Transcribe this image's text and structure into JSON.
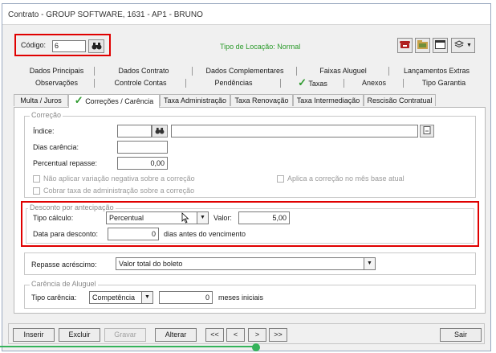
{
  "window": {
    "title": "Contrato - GROUP SOFTWARE, 1631 - AP1 - BRUNO"
  },
  "header": {
    "codigo_label": "Código:",
    "codigo_value": "6",
    "tipo_locacao": "Tipo de Locação:  Normal",
    "icons": [
      "binoculars-icon",
      "phone-icon",
      "folder-icon",
      "window-icon",
      "layers-icon"
    ]
  },
  "tabs_row1": [
    "Dados Principais",
    "Dados Contrato",
    "Dados Complementares",
    "Faixas Aluguel",
    "Lançamentos Extras"
  ],
  "tabs_row2": [
    "Observações",
    "Controle Contas",
    "Pendências",
    "Taxas",
    "Anexos",
    "Tipo Garantia"
  ],
  "subtabs": [
    "Multa / Juros",
    "Correções / Carência",
    "Taxa Administração",
    "Taxa Renovação",
    "Taxa Intermediação",
    "Rescisão Contratual"
  ],
  "correcao": {
    "title": "Correção",
    "indice_label": "Índice:",
    "dias_carencia_label": "Dias carência:",
    "percentual_label": "Percentual repasse:",
    "percentual_value": "0,00",
    "cb_nao_aplicar": "Não aplicar variação negativa sobre a correção",
    "cb_aplica_mes": "Aplica a correção no mês base atual",
    "cb_cobrar": "Cobrar taxa de administração sobre a correção"
  },
  "desconto": {
    "title": "Desconto por antecipação",
    "tipo_calculo_label": "Tipo cálculo:",
    "tipo_calculo_value": "Percentual",
    "valor_label": "Valor:",
    "valor_value": "5,00",
    "data_label": "Data para desconto:",
    "data_value": "0",
    "data_suffix": "dias antes do vencimento"
  },
  "repasse": {
    "label": "Repasse acréscimo:",
    "value": "Valor total do boleto"
  },
  "carencia": {
    "title": "Carência de Aluguel",
    "tipo_label": "Tipo carência:",
    "tipo_value": "Competência",
    "meses_value": "0",
    "meses_suffix": "meses iniciais"
  },
  "buttons": {
    "inserir": "Inserir",
    "excluir": "Excluir",
    "gravar": "Gravar",
    "alterar": "Alterar",
    "first": "<<",
    "prev": "<",
    "next": ">",
    "last": ">>",
    "sair": "Sair"
  },
  "colors": {
    "check_green": "#2f9a2f",
    "highlight_red": "#e00000",
    "progress_green": "#35b35a"
  }
}
